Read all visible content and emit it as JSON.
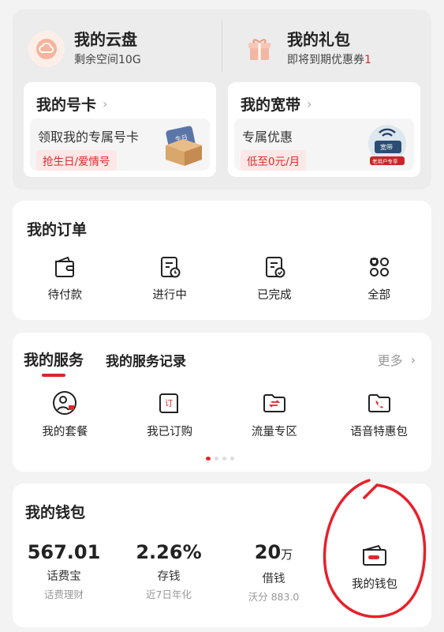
{
  "top": {
    "cloud": {
      "title": "我的云盘",
      "subtitle": "剩余空间10G",
      "icon": "cloud-icon"
    },
    "gift": {
      "title": "我的礼包",
      "subtitle_prefix": "即将到期优惠券",
      "count": "1",
      "icon": "gift-icon"
    },
    "sim": {
      "title": "我的号卡",
      "desc": "领取我的专属号卡",
      "tag": "抢生日/爱情号",
      "art_text": "生日"
    },
    "broadband": {
      "title": "我的宽带",
      "desc": "专属优惠",
      "tag": "低至0元/月",
      "art_text": "宽带",
      "art_banner": "老用户专享"
    }
  },
  "orders": {
    "title": "我的订单",
    "items": [
      {
        "label": "待付款",
        "icon": "wallet-icon"
      },
      {
        "label": "进行中",
        "icon": "document-clock-icon"
      },
      {
        "label": "已完成",
        "icon": "document-check-icon"
      },
      {
        "label": "全部",
        "icon": "grid-icon"
      }
    ]
  },
  "services": {
    "tab_active": "我的服务",
    "tab_other": "我的服务记录",
    "more": "更多",
    "items": [
      {
        "label": "我的套餐",
        "icon": "user-badge-icon"
      },
      {
        "label": "我已订购",
        "icon": "order-doc-icon",
        "glyph": "订"
      },
      {
        "label": "流量专区",
        "icon": "folder-exchange-icon"
      },
      {
        "label": "语音特惠包",
        "icon": "folder-phone-icon"
      }
    ],
    "pager": {
      "pages": 4,
      "active": 1
    }
  },
  "wallet": {
    "title": "我的钱包",
    "cols": [
      {
        "value": "567.01",
        "unit": "",
        "label": "话费宝",
        "sub": "话费理财"
      },
      {
        "value": "2.26%",
        "unit": "",
        "label": "存钱",
        "sub": "近7日年化"
      },
      {
        "value": "20",
        "unit": "万",
        "label": "借钱",
        "sub": "沃分 883.0"
      }
    ],
    "entry": {
      "label": "我的钱包",
      "icon": "wallet-icon"
    }
  },
  "colors": {
    "accent": "#e0262a",
    "annotation": "#e8202a"
  }
}
